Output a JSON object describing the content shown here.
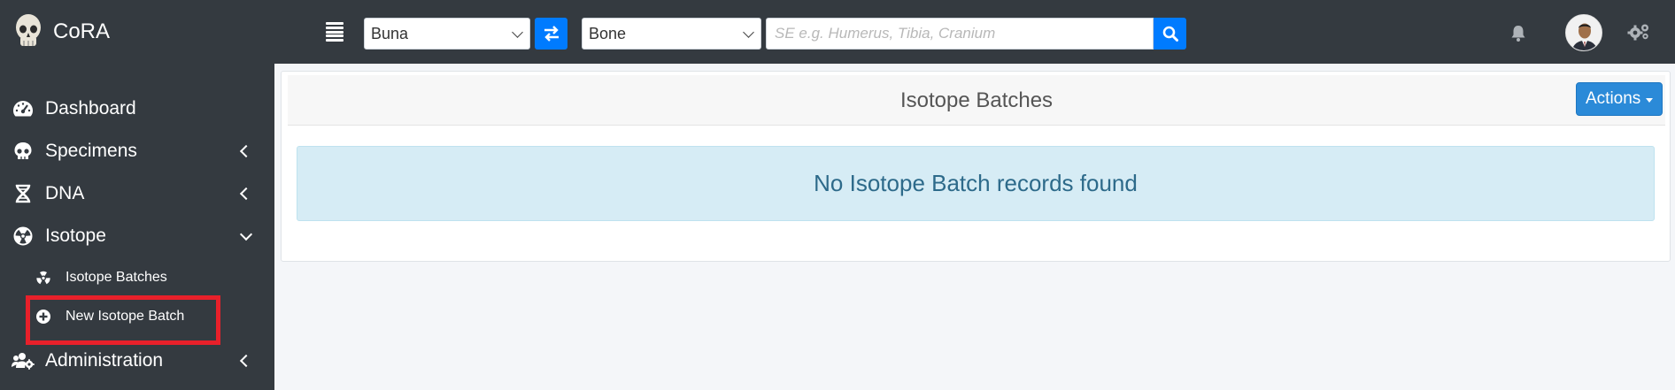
{
  "app": {
    "name": "CoRA",
    "logo_icon": "skull-icon"
  },
  "toolbar": {
    "menu_icon": "hamburger-menu-icon",
    "collection_select": {
      "value": "Buna"
    },
    "swap_icon": "swap-arrows-icon",
    "type_select": {
      "value": "Bone"
    },
    "search": {
      "value": "",
      "placeholder": "SE e.g. Humerus, Tibia, Cranium"
    },
    "search_icon": "search-icon",
    "notification_icon": "bell-icon",
    "avatar": "user-avatar",
    "settings_icon": "gears-icon"
  },
  "sidebar": {
    "items": [
      {
        "label": "Dashboard",
        "icon": "tachometer-icon",
        "has_arrow": false
      },
      {
        "label": "Specimens",
        "icon": "skull-icon",
        "has_arrow": true,
        "expanded": false
      },
      {
        "label": "DNA",
        "icon": "dna-icon",
        "has_arrow": true,
        "expanded": false
      },
      {
        "label": "Isotope",
        "icon": "radiation-icon",
        "has_arrow": true,
        "expanded": true
      },
      {
        "label": "Administration",
        "icon": "users-cog-icon",
        "has_arrow": true,
        "expanded": false
      }
    ],
    "isotope_children": [
      {
        "label": "Isotope Batches",
        "icon": "radiation-alt-icon"
      },
      {
        "label": "New Isotope Batch",
        "icon": "plus-circle-icon",
        "highlighted": true
      }
    ]
  },
  "main": {
    "card_title": "Isotope Batches",
    "actions_label": "Actions",
    "empty_message": "No Isotope Batch records found"
  },
  "colors": {
    "navbar": "#343a40",
    "primary": "#007bff",
    "alert_bg": "#d6ecf5",
    "alert_text": "#2d6a8a",
    "highlight_border": "#e8202a"
  }
}
